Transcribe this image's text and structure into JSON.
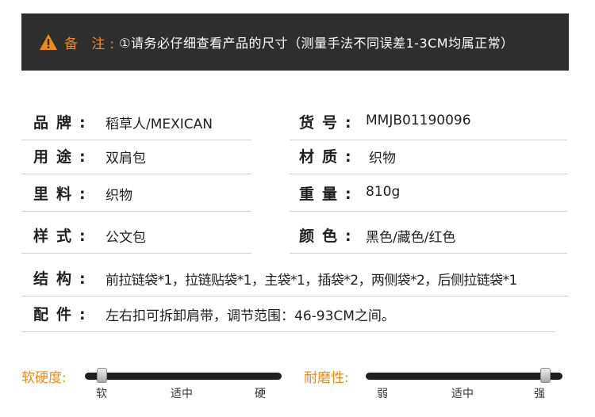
{
  "notice": {
    "label": "备 注:",
    "text": "①请务必仔细查看产品的尺寸（测量手法不同误差1-3CM均属正常）",
    "accent": "#f08a1b"
  },
  "specs": {
    "brand": {
      "label": [
        "品",
        "牌"
      ],
      "value": "稻草人/MEXICAN"
    },
    "item_no": {
      "label": [
        "货",
        "号"
      ],
      "value": "MMJB01190096"
    },
    "usage": {
      "label": [
        "用",
        "途"
      ],
      "value": "双肩包"
    },
    "material": {
      "label": [
        "材",
        "质"
      ],
      "value": "织物"
    },
    "lining": {
      "label": [
        "里",
        "料"
      ],
      "value": "织物"
    },
    "weight": {
      "label": [
        "重",
        "量"
      ],
      "value": "810g"
    },
    "style": {
      "label": [
        "样",
        "式"
      ],
      "value": "公文包"
    },
    "color": {
      "label": [
        "颜",
        "色"
      ],
      "value": "黑色/藏色/红色"
    },
    "structure": {
      "label": [
        "结",
        "构"
      ],
      "value": "前拉链袋*1，拉链贴袋*1，主袋*1，插袋*2，两侧袋*2，后侧拉链袋*1"
    },
    "accessory": {
      "label": [
        "配",
        "件"
      ],
      "value": "左右扣可拆卸肩带，调节范围：46-93CM之间。"
    }
  },
  "scales": {
    "softness": {
      "title": "软硬度:",
      "ticks": [
        "软",
        "适中",
        "硬"
      ],
      "level": 0
    },
    "durability": {
      "title": "耐磨性:",
      "ticks": [
        "弱",
        "适中",
        "强"
      ],
      "level": 1
    }
  }
}
